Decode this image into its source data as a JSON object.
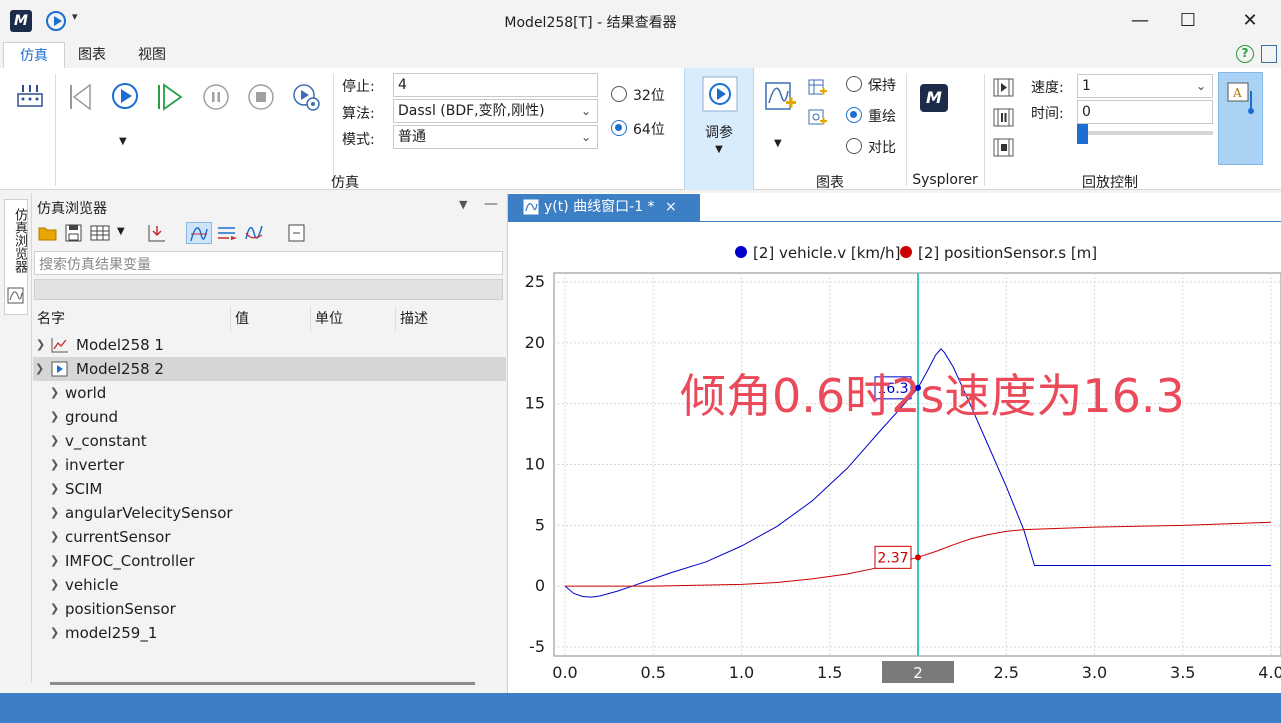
{
  "window": {
    "title": "Model258[T] - 结果查看器",
    "minimize": "—",
    "maximize": "☐",
    "close": "✕"
  },
  "menu_tabs": [
    "仿真",
    "图表",
    "视图"
  ],
  "ribbon": {
    "stop_label": "停止:",
    "stop_value": "4",
    "algo_label": "算法:",
    "algo_value": "Dassl (BDF,变阶,刚性)",
    "mode_label": "模式:",
    "mode_value": "普通",
    "bit32": "32位",
    "bit64": "64位",
    "tune": "调参",
    "keep": "保持",
    "redraw": "重绘",
    "compare": "对比",
    "speed_label": "速度:",
    "speed_value": "1",
    "time_label": "时间:",
    "time_value": "0",
    "slider_value": 0,
    "groups": {
      "sim": "仿真",
      "chart": "图表",
      "sysplorer": "Sysplorer",
      "playback": "回放控制"
    }
  },
  "browser": {
    "title": "仿真浏览器",
    "side_tab": "仿真浏览器",
    "search_placeholder": "搜索仿真结果变量",
    "columns": [
      "名字",
      "值",
      "单位",
      "描述"
    ],
    "roots": [
      {
        "label": "Model258 1",
        "icon": "chart-icon",
        "expanded": false
      },
      {
        "label": "Model258 2",
        "icon": "model-icon",
        "expanded": true
      }
    ],
    "children": [
      "world",
      "ground",
      "v_constant",
      "inverter",
      "SCIM",
      "angularVelecitySensor",
      "currentSensor",
      "IMFOC_Controller",
      "vehicle",
      "positionSensor",
      "model259_1"
    ]
  },
  "plot_tab": {
    "title": "y(t) 曲线窗口-1 *",
    "close": "×"
  },
  "annotation": "倾角0.6时2s速度为16.3",
  "chart_data": {
    "type": "line",
    "xlim": [
      0,
      4
    ],
    "ylim": [
      -5,
      25
    ],
    "xticks": [
      0.0,
      0.5,
      1.0,
      1.5,
      2,
      2.5,
      3.0,
      3.5,
      4.0
    ],
    "xtick_labels": [
      "0.0",
      "0.5",
      "1.0",
      "1.5",
      "2",
      "2.5",
      "3.0",
      "3.5",
      "4.0"
    ],
    "yticks": [
      -5,
      0,
      5,
      10,
      15,
      20,
      25
    ],
    "grid": true,
    "legend": "top",
    "cursor_x": 2,
    "series": [
      {
        "name": "[2] vehicle.v [km/h]",
        "color": "#0000cc",
        "x": [
          0,
          0.05,
          0.1,
          0.15,
          0.2,
          0.3,
          0.4,
          0.5,
          0.6,
          0.8,
          1.0,
          1.2,
          1.4,
          1.6,
          1.8,
          1.9,
          2.0,
          2.05,
          2.1,
          2.13,
          2.15,
          2.2,
          2.3,
          2.4,
          2.5,
          2.6,
          2.66,
          3.0,
          3.5,
          4.0
        ],
        "y": [
          0,
          -0.6,
          -0.85,
          -0.9,
          -0.8,
          -0.4,
          0.1,
          0.6,
          1.1,
          2.0,
          3.3,
          4.9,
          7.0,
          9.7,
          13.0,
          14.6,
          16.3,
          17.6,
          19.0,
          19.5,
          19.2,
          18.0,
          14.8,
          11.5,
          8.2,
          4.6,
          1.7,
          1.7,
          1.7,
          1.7
        ],
        "marker_label": "16.3"
      },
      {
        "name": "[2] positionSensor.s [m]",
        "color": "#cc0000",
        "x": [
          0,
          0.5,
          1.0,
          1.2,
          1.4,
          1.6,
          1.8,
          2.0,
          2.1,
          2.2,
          2.3,
          2.4,
          2.5,
          2.6,
          2.8,
          3.0,
          3.5,
          4.0
        ],
        "y": [
          0,
          0,
          0.15,
          0.3,
          0.6,
          1.0,
          1.6,
          2.37,
          2.85,
          3.4,
          3.9,
          4.25,
          4.5,
          4.65,
          4.75,
          4.85,
          5.0,
          5.25
        ],
        "marker_label": "2.37"
      }
    ]
  }
}
